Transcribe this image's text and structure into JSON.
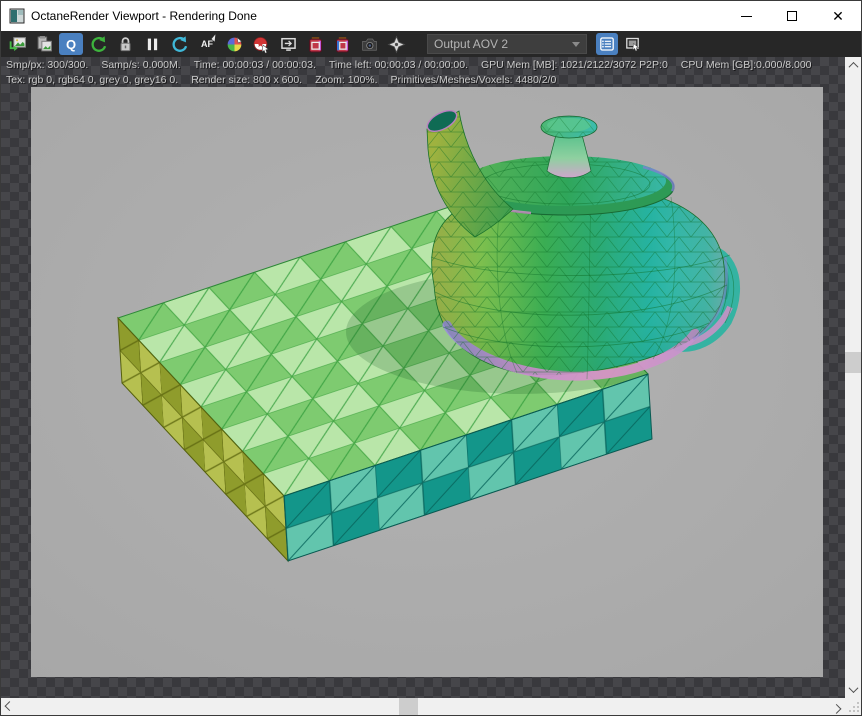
{
  "window": {
    "title": "OctaneRender Viewport - Rendering Done",
    "controls": {
      "close_glyph": "✕"
    }
  },
  "toolbar": {
    "q_label": "Q",
    "af_label": "AF",
    "output_aov": {
      "value": "Output AOV 2"
    }
  },
  "status": {
    "line1": [
      "Smp/px: 300/300.",
      "Samp/s: 0.000M.",
      "Time: 00:00:03 / 00:00:03.",
      "Time left: 00:00:03 / 00:00:00.",
      "GPU Mem [MB]: 1021/2122/3072 P2P:0",
      "CPU Mem [GB]:0.000/8.000"
    ],
    "line2": [
      "Tex: rgb 0, rgb64 0, grey 0, grey16 0.",
      "Render size: 800 x 600.",
      "Zoom: 100%.",
      "Primitives/Meshes/Voxels: 4480/2/0"
    ]
  },
  "viewport": {
    "render_background": "#adadad",
    "checker_dark": "#39393d",
    "checker_light": "#46464a"
  },
  "scene_colors": {
    "accent_blue": "#4a80c0",
    "slab_green_light": "#b9e6a9",
    "slab_green_dark": "#7ecb70",
    "slab_side_olive": "#a9b545",
    "slab_side_teal": "#13968a",
    "teapot_green": "#3aad53",
    "teapot_cyan": "#2fb5a6",
    "teapot_pink": "#cf8fc8"
  }
}
